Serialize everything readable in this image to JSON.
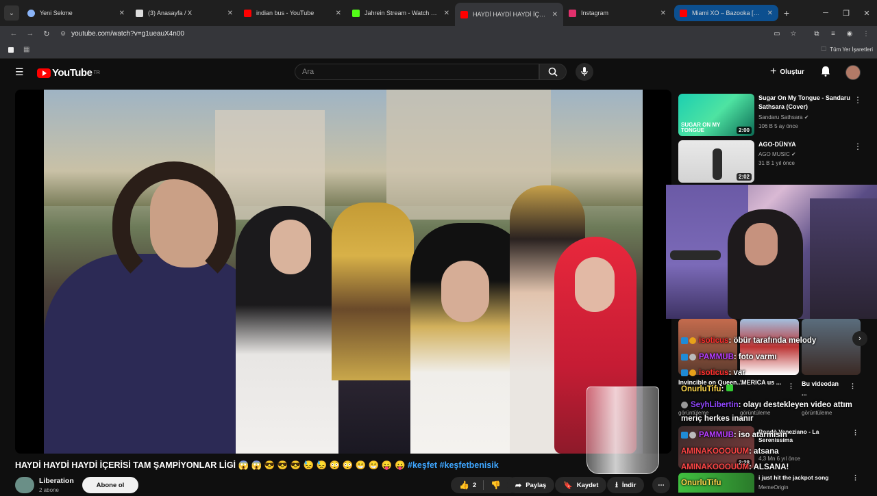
{
  "browser": {
    "tabs": [
      {
        "title": "Yeni Sekme",
        "favicon_color": "#8ab4f8"
      },
      {
        "title": "(3) Anasayfa / X",
        "favicon_color": "#dddddd"
      },
      {
        "title": "indian bus - YouTube",
        "favicon_color": "#ff0000"
      },
      {
        "title": "Jahrein Stream - Watch Live on",
        "favicon_color": "#53fc18"
      },
      {
        "title": "HAYDİ HAYDİ HAYDİ İÇERİSİ TA",
        "favicon_color": "#ff0000"
      },
      {
        "title": "Instagram",
        "favicon_color": "#e1306c"
      },
      {
        "title": "Miami XO – Bazooka [Rest in p",
        "favicon_color": "#ff0000"
      }
    ],
    "new_tab": "+",
    "url": "youtube.com/watch?v=g1ueauX4n00",
    "bookmarks_folder": "Tüm Yer İşaretleri"
  },
  "youtube": {
    "logo_text": "YouTube",
    "region": "TR",
    "search_placeholder": "Ara",
    "create_label": "Oluştur",
    "video": {
      "title": "HAYDİ HAYDİ HAYDİ İÇERİSİ TAM ŞAMPİYONLAR LİGİ 😱 😱 😎 😎 😎 😓 😓 😳 😳 😁 😁 😛 😛",
      "hashtags": "#keşfet #keşfetbenisik",
      "channel": "Liberation",
      "subscribers": "2 abone",
      "subscribe_label": "Abone ol",
      "likes": "2",
      "share_label": "Paylaş",
      "save_label": "Kaydet",
      "download_label": "İndir"
    },
    "recommendations": [
      {
        "title": "Sugar On My Tongue - Sandaru Sathsara (Cover)",
        "channel": "Sandaru Sathsara",
        "meta": "106 B  5 ay önce",
        "duration": "2:00",
        "thumb_text": "SUGAR ON MY TONGUE"
      },
      {
        "title": "AGO-DÜNYA",
        "channel": "AGO MUSIC",
        "meta": "31 B  1 yıl önce",
        "duration": "2:02"
      }
    ],
    "shorts": [
      {
        "title": "Invincible on Queen...",
        "meta": "görüntüleme"
      },
      {
        "title": "'MERICA us ...",
        "meta": "görüntüleme"
      },
      {
        "title": "Bu videodan ...",
        "meta": "görüntüleme"
      }
    ],
    "more_recs": [
      {
        "title": "Rondò Veneziano - La Serenissima",
        "meta": "4,3 Mn  6 yıl önce",
        "duration": "2:28"
      },
      {
        "title": "i just hit the jackpot song",
        "channel": "MemeOrigin"
      }
    ]
  },
  "chat_overlay": [
    {
      "user": "isoticus",
      "text": ": öbür tarafında melody"
    },
    {
      "user": "PAMMUB",
      "text": ": foto varmı"
    },
    {
      "user": "isoticus",
      "text": ": var"
    },
    {
      "user": "OnurluTifu",
      "text": ":"
    },
    {
      "user": "SeyhLibertin",
      "text": ": olayı destekleyen video attım"
    },
    {
      "user": "",
      "text": "meriç herkes inanır"
    },
    {
      "user": "PAMMUB",
      "text": ": iso atarmısın"
    },
    {
      "user": "AMINAKOOOUUM",
      "text": ": atsana"
    },
    {
      "user": "AMINAKOOOUUM",
      "text": ": ALSANA!"
    },
    {
      "user": "OnurluTifu",
      "text": ""
    }
  ]
}
